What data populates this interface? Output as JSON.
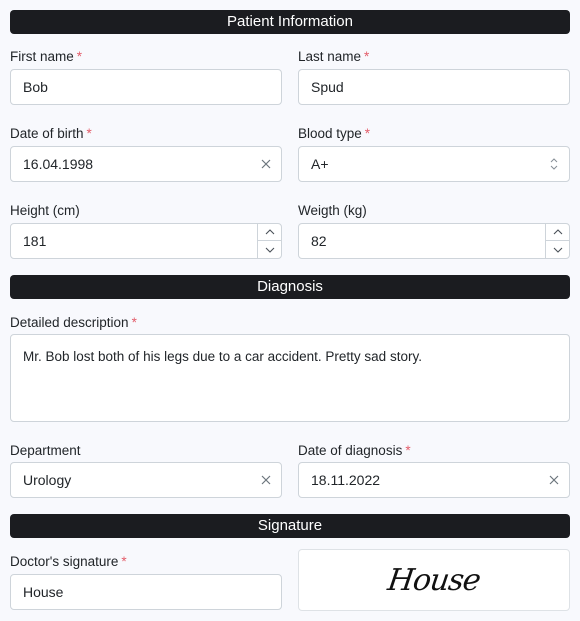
{
  "sections": {
    "patient": "Patient Information",
    "diagnosis": "Diagnosis",
    "signature": "Signature"
  },
  "required_marker": "*",
  "fields": {
    "first_name": {
      "label": "First name",
      "value": "Bob",
      "required": true
    },
    "last_name": {
      "label": "Last name",
      "value": "Spud",
      "required": true
    },
    "date_of_birth": {
      "label": "Date of birth",
      "value": "16.04.1998",
      "required": true
    },
    "blood_type": {
      "label": "Blood type",
      "value": "A+",
      "required": true
    },
    "height": {
      "label": "Height (cm)",
      "value": "181",
      "required": false
    },
    "weight": {
      "label": "Weigth (kg)",
      "value": "82",
      "required": false
    },
    "description": {
      "label": "Detailed description",
      "value": "Mr. Bob lost both of his legs due to a car accident. Pretty sad story.",
      "required": true
    },
    "department": {
      "label": "Department",
      "value": "Urology",
      "required": false
    },
    "date_of_diagnosis": {
      "label": "Date of diagnosis",
      "value": "18.11.2022",
      "required": true
    },
    "doctor_signature": {
      "label": "Doctor's signature",
      "value": "House",
      "required": true
    }
  },
  "signature_preview": "House",
  "colors": {
    "header_bg": "#1b1c20",
    "required": "#e35d6a",
    "page_bg": "#f8f9fd"
  }
}
